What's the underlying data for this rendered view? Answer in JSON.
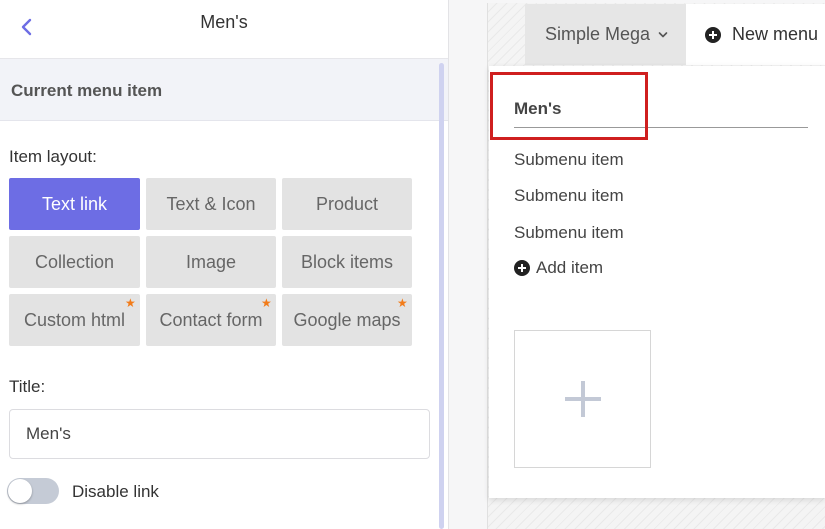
{
  "header": {
    "title": "Men's"
  },
  "section": {
    "title": "Current menu item"
  },
  "layout": {
    "label": "Item layout:",
    "options": [
      {
        "label": "Text link",
        "active": true,
        "pro": false
      },
      {
        "label": "Text & Icon",
        "active": false,
        "pro": false
      },
      {
        "label": "Product",
        "active": false,
        "pro": false
      },
      {
        "label": "Collection",
        "active": false,
        "pro": false
      },
      {
        "label": "Image",
        "active": false,
        "pro": false
      },
      {
        "label": "Block items",
        "active": false,
        "pro": false
      },
      {
        "label": "Custom html",
        "active": false,
        "pro": true
      },
      {
        "label": "Contact form",
        "active": false,
        "pro": true
      },
      {
        "label": "Google maps",
        "active": false,
        "pro": true
      }
    ]
  },
  "title_field": {
    "label": "Title:",
    "value": "Men's"
  },
  "disable_link": {
    "label": "Disable link",
    "enabled": false
  },
  "preview": {
    "menu_tab": "Simple Mega",
    "new_menu": "New menu",
    "dropdown": {
      "heading": "Men's",
      "items": [
        "Submenu item",
        "Submenu item",
        "Submenu item"
      ],
      "add_item": "Add item"
    }
  },
  "colors": {
    "accent": "#6d6de4",
    "highlight": "#cf1f1f",
    "pro_star": "#f27c1a"
  }
}
